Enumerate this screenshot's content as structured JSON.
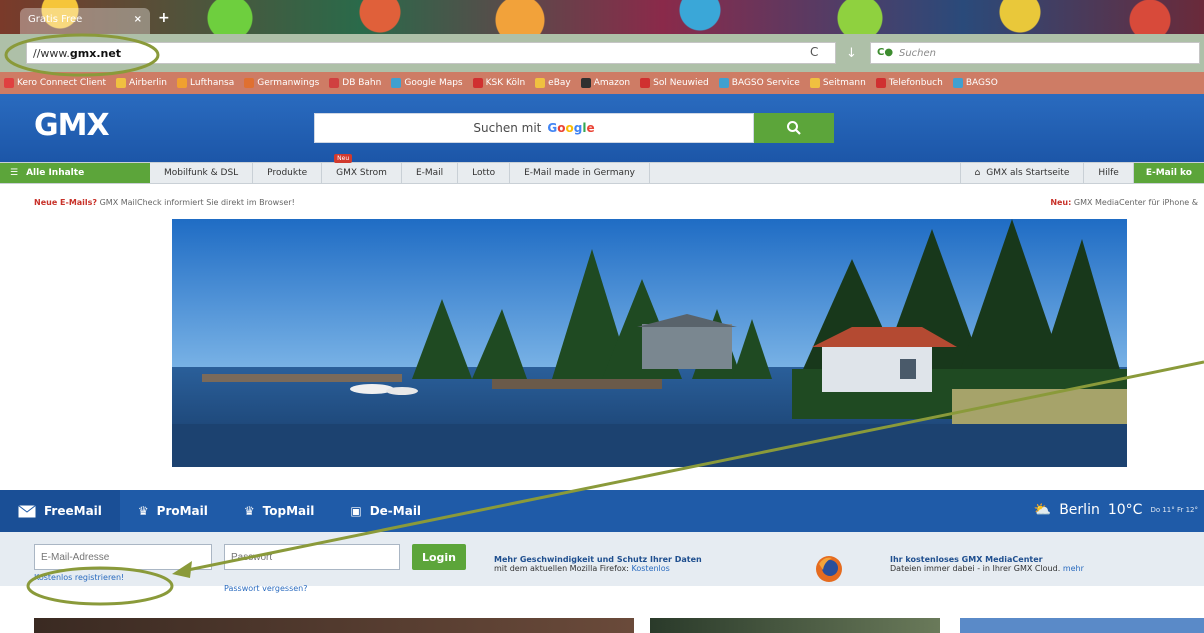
{
  "browser": {
    "tab_title": "Gratis Free",
    "tab_close": "×",
    "new_tab": "+",
    "url_prefix": "//www.",
    "url_domain": "gmx.net",
    "reload": "C",
    "search_placeholder": "Suchen",
    "bookmarks": [
      "Kero Connect Client",
      "Airberlin",
      "Lufthansa",
      "Germanwings",
      "DB Bahn",
      "Google Maps",
      "KSK Köln",
      "eBay",
      "Amazon",
      "Sol Neuwied",
      "BAGSO Service",
      "Seitmann",
      "Telefonbuch",
      "BAGSO"
    ]
  },
  "gmx": {
    "logo": "GMX",
    "search_prefix": "Suchen mit",
    "search_google": [
      "G",
      "o",
      "o",
      "g",
      "l",
      "e"
    ],
    "nav": {
      "all": "Alle Inhalte",
      "items": [
        "Mobilfunk & DSL",
        "Produkte",
        "GMX Strom",
        "E-Mail",
        "Lotto",
        "E-Mail made in Germany"
      ],
      "new_badge": "Neu",
      "right": [
        "GMX als Startseite",
        "Hilfe"
      ],
      "right_green": "E-Mail ko"
    },
    "notice_left_red": "Neue E-Mails?",
    "notice_left": "GMX MailCheck informiert Sie direkt im Browser!",
    "notice_right_red": "Neu:",
    "notice_right": "GMX MediaCenter für iPhone &"
  },
  "login": {
    "tabs": [
      "FreeMail",
      "ProMail",
      "TopMail",
      "De-Mail"
    ],
    "weather_city": "Berlin",
    "weather_temp": "10°C",
    "weather_forecast": "Do 11°  Fr 12°",
    "email_placeholder": "E-Mail-Adresse",
    "password_placeholder": "Passwort",
    "login_button": "Login",
    "register_link": "Kostenlos registrieren!",
    "forgot_link": "Passwort vergessen?",
    "promo1_title": "Mehr Geschwindigkeit und Schutz Ihrer Daten",
    "promo1_text": "mit dem aktuellen Mozilla Firefox:",
    "promo1_link": "Kostenlos",
    "promo2_title": "Ihr kostenloses GMX MediaCenter",
    "promo2_text": "Dateien immer dabei - in Ihrer GMX Cloud.",
    "promo2_link": "mehr"
  },
  "colors": {
    "gmx_blue": "#1f5ba8",
    "green": "#5ca53a",
    "annotation": "#8a9a3a"
  }
}
